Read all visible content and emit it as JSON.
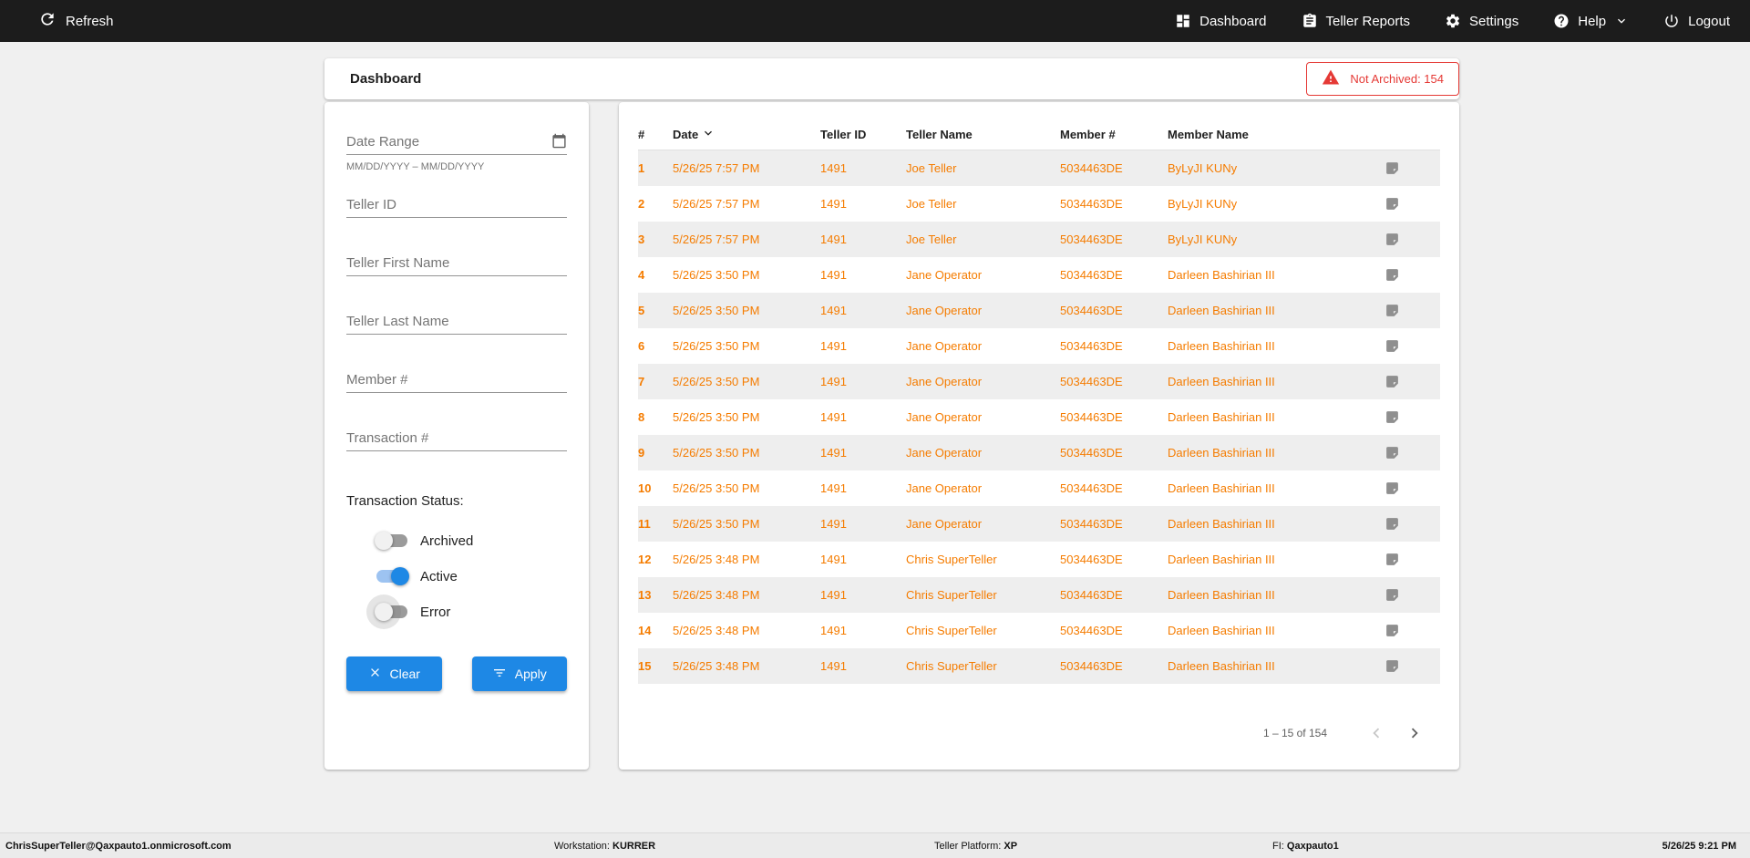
{
  "topbar": {
    "refresh_label": "Refresh",
    "nav": [
      {
        "label": "Dashboard",
        "icon": "dashboard-grid-icon"
      },
      {
        "label": "Teller Reports",
        "icon": "clipboard-icon"
      },
      {
        "label": "Settings",
        "icon": "gear-icon"
      },
      {
        "label": "Help",
        "icon": "help-circle-icon"
      },
      {
        "label": "Logout",
        "icon": "power-icon"
      }
    ]
  },
  "header": {
    "title": "Dashboard",
    "not_archived_label": "Not Archived: 154"
  },
  "filters": {
    "date_range_placeholder": "Date Range",
    "date_range_helper": "MM/DD/YYYY – MM/DD/YYYY",
    "teller_id_placeholder": "Teller ID",
    "teller_first_name_placeholder": "Teller First Name",
    "teller_last_name_placeholder": "Teller Last Name",
    "member_placeholder": "Member #",
    "transaction_placeholder": "Transaction #",
    "status_label": "Transaction Status:",
    "toggles": [
      {
        "label": "Archived",
        "state": "off"
      },
      {
        "label": "Active",
        "state": "on"
      },
      {
        "label": "Error",
        "state": "off"
      }
    ],
    "clear_label": "Clear",
    "apply_label": "Apply"
  },
  "table": {
    "columns": [
      "#",
      "Date",
      "Teller ID",
      "Teller Name",
      "Member #",
      "Member Name"
    ],
    "rows": [
      {
        "num": "1",
        "date": "5/26/25 7:57 PM",
        "teller_id": "1491",
        "teller_name": "Joe Teller",
        "member_num": "5034463DE",
        "member_name": "ByLyJI KUNy"
      },
      {
        "num": "2",
        "date": "5/26/25 7:57 PM",
        "teller_id": "1491",
        "teller_name": "Joe Teller",
        "member_num": "5034463DE",
        "member_name": "ByLyJI KUNy"
      },
      {
        "num": "3",
        "date": "5/26/25 7:57 PM",
        "teller_id": "1491",
        "teller_name": "Joe Teller",
        "member_num": "5034463DE",
        "member_name": "ByLyJI KUNy"
      },
      {
        "num": "4",
        "date": "5/26/25 3:50 PM",
        "teller_id": "1491",
        "teller_name": "Jane Operator",
        "member_num": "5034463DE",
        "member_name": "Darleen Bashirian III"
      },
      {
        "num": "5",
        "date": "5/26/25 3:50 PM",
        "teller_id": "1491",
        "teller_name": "Jane Operator",
        "member_num": "5034463DE",
        "member_name": "Darleen Bashirian III"
      },
      {
        "num": "6",
        "date": "5/26/25 3:50 PM",
        "teller_id": "1491",
        "teller_name": "Jane Operator",
        "member_num": "5034463DE",
        "member_name": "Darleen Bashirian III"
      },
      {
        "num": "7",
        "date": "5/26/25 3:50 PM",
        "teller_id": "1491",
        "teller_name": "Jane Operator",
        "member_num": "5034463DE",
        "member_name": "Darleen Bashirian III"
      },
      {
        "num": "8",
        "date": "5/26/25 3:50 PM",
        "teller_id": "1491",
        "teller_name": "Jane Operator",
        "member_num": "5034463DE",
        "member_name": "Darleen Bashirian III"
      },
      {
        "num": "9",
        "date": "5/26/25 3:50 PM",
        "teller_id": "1491",
        "teller_name": "Jane Operator",
        "member_num": "5034463DE",
        "member_name": "Darleen Bashirian III"
      },
      {
        "num": "10",
        "date": "5/26/25 3:50 PM",
        "teller_id": "1491",
        "teller_name": "Jane Operator",
        "member_num": "5034463DE",
        "member_name": "Darleen Bashirian III"
      },
      {
        "num": "11",
        "date": "5/26/25 3:50 PM",
        "teller_id": "1491",
        "teller_name": "Jane Operator",
        "member_num": "5034463DE",
        "member_name": "Darleen Bashirian III"
      },
      {
        "num": "12",
        "date": "5/26/25 3:48 PM",
        "teller_id": "1491",
        "teller_name": "Chris SuperTeller",
        "member_num": "5034463DE",
        "member_name": "Darleen Bashirian III"
      },
      {
        "num": "13",
        "date": "5/26/25 3:48 PM",
        "teller_id": "1491",
        "teller_name": "Chris SuperTeller",
        "member_num": "5034463DE",
        "member_name": "Darleen Bashirian III"
      },
      {
        "num": "14",
        "date": "5/26/25 3:48 PM",
        "teller_id": "1491",
        "teller_name": "Chris SuperTeller",
        "member_num": "5034463DE",
        "member_name": "Darleen Bashirian III"
      },
      {
        "num": "15",
        "date": "5/26/25 3:48 PM",
        "teller_id": "1491",
        "teller_name": "Chris SuperTeller",
        "member_num": "5034463DE",
        "member_name": "Darleen Bashirian III"
      }
    ],
    "pagination_label": "1 – 15 of 154"
  },
  "statusbar": {
    "user": "ChrisSuperTeller@Qaxpauto1.onmicrosoft.com",
    "workstation_label": "Workstation:",
    "workstation_value": "KURRER",
    "platform_label": "Teller Platform:",
    "platform_value": "XP",
    "fi_label": "FI:",
    "fi_value": "Qaxpauto1",
    "datetime": "5/26/25 9:21 PM"
  },
  "colors": {
    "accent_orange": "#F57C00",
    "primary_blue": "#1E88E5",
    "alert_red": "#E53935",
    "topbar_bg": "#1C1C1C"
  }
}
